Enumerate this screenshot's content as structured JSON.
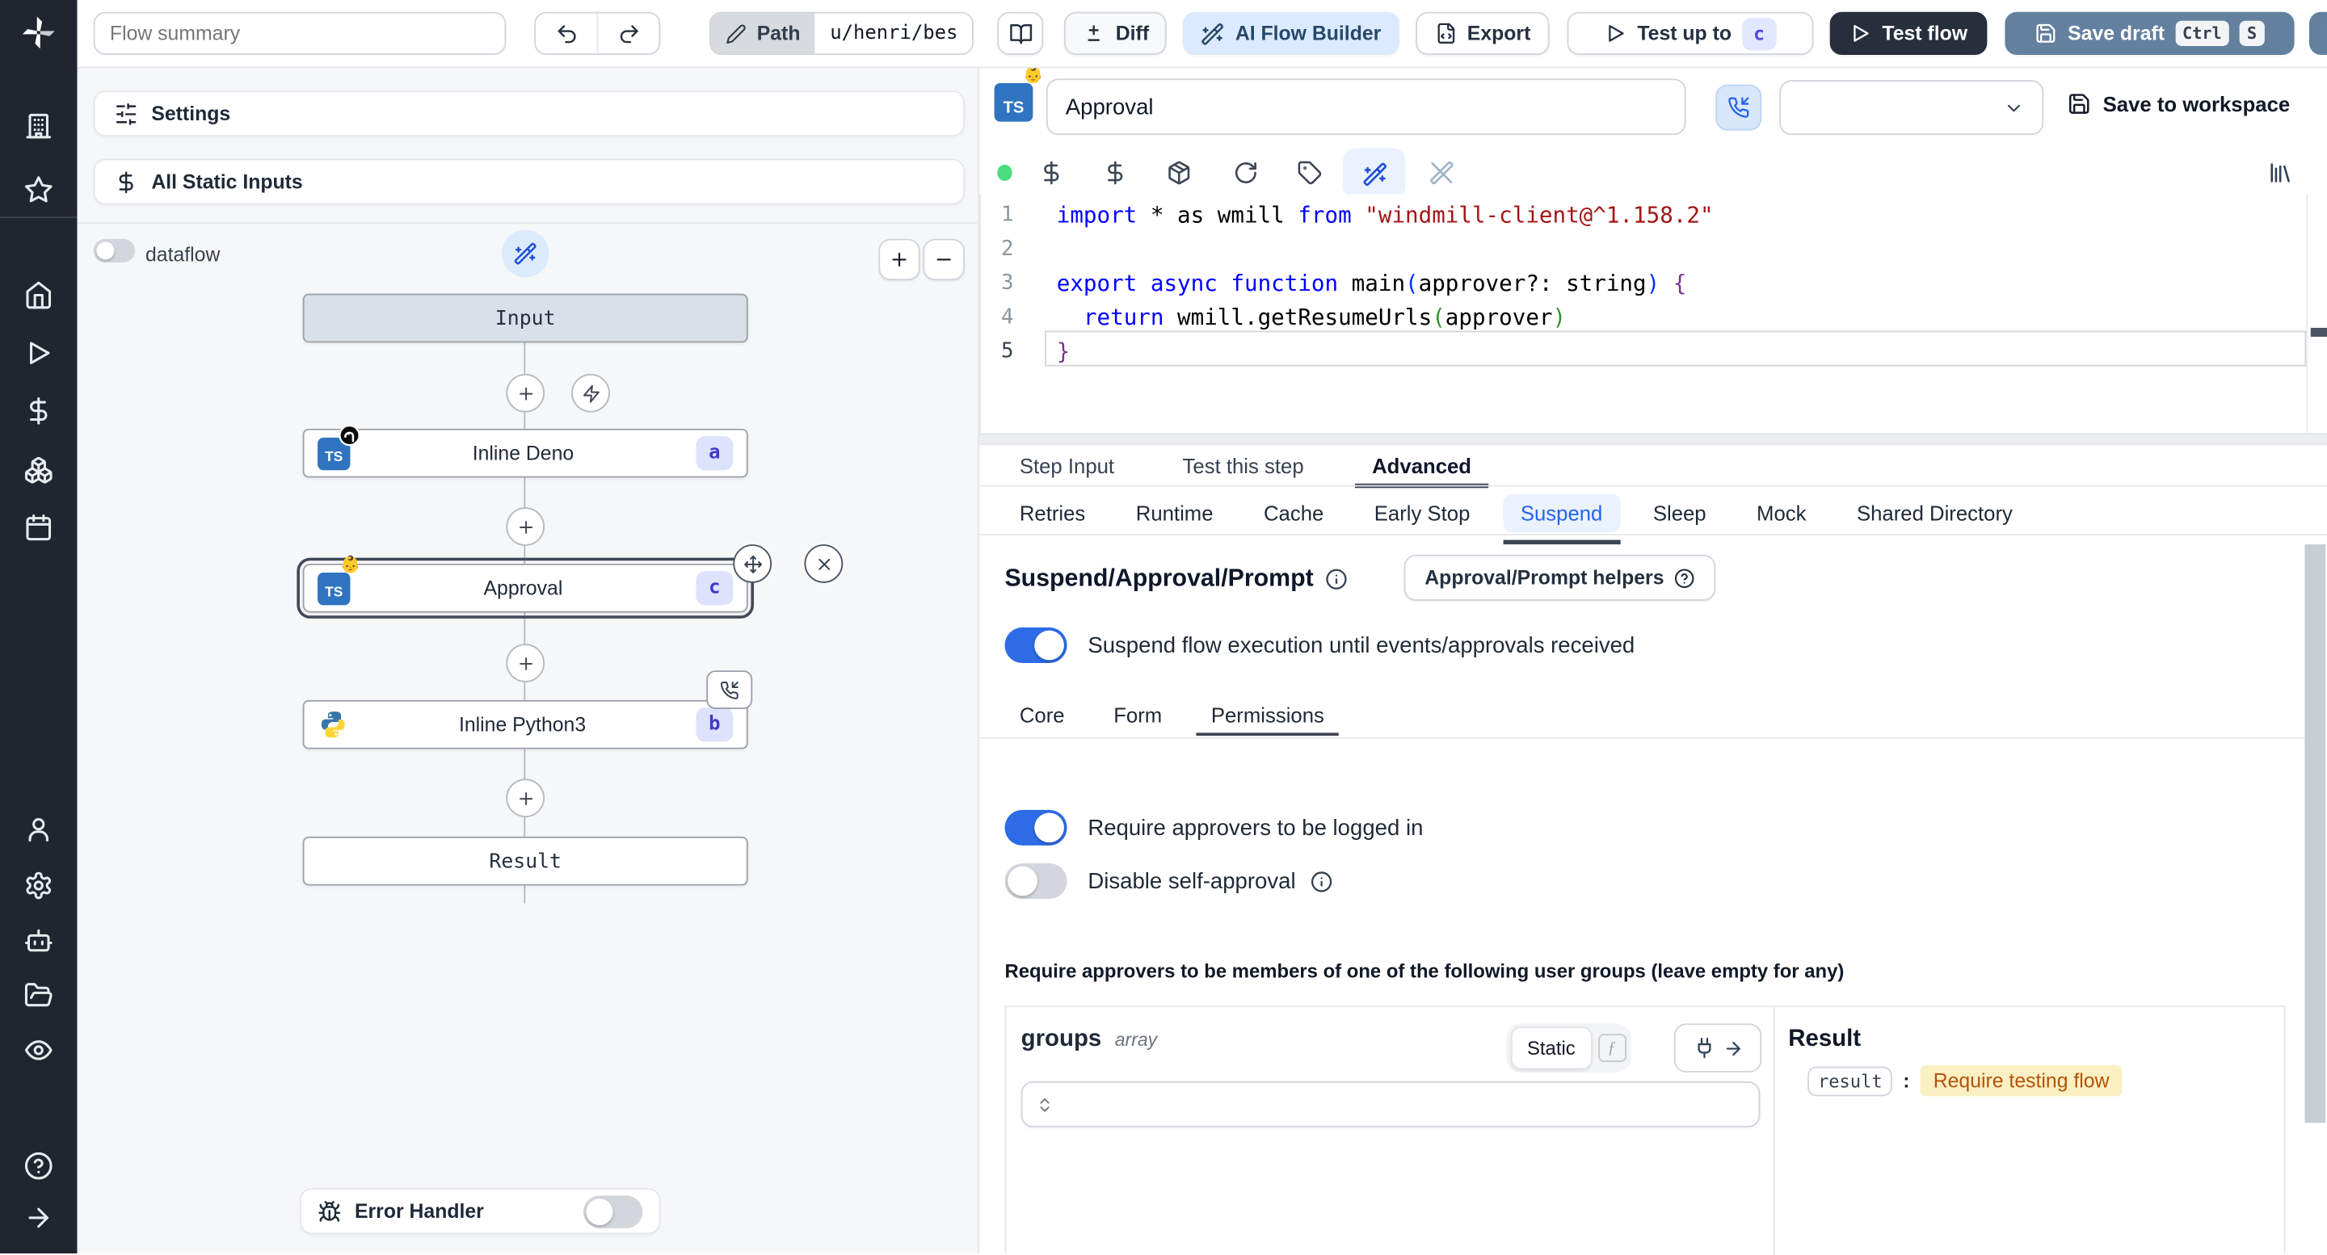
{
  "colors": {
    "accent_blue": "#2e6be6",
    "badge_bg": "#dde3fc",
    "badge_text": "#4338ca",
    "highlight_bg": "#fbf0c4",
    "highlight_text": "#b45309",
    "rail_bg": "#21252f",
    "save_btn": "#64809f",
    "test_flow_btn": "#272f3d"
  },
  "topbar": {
    "flow_summary": "Flow summary",
    "path_label": "Path",
    "path_value": "u/henri/bes",
    "diff_label": "Diff",
    "ai_flow_builder_label": "AI Flow Builder",
    "export_label": "Export",
    "test_up_to_label": "Test up to",
    "test_up_to_badge": "c",
    "test_flow_label": "Test flow",
    "save_draft_label": "Save draft",
    "kbd_ctrl": "Ctrl",
    "kbd_s": "S"
  },
  "rail": {
    "icons": [
      "windmill-logo",
      "building",
      "star",
      "home",
      "play",
      "dollar",
      "boxes",
      "calendar",
      "user",
      "gear",
      "bot",
      "folder",
      "eye",
      "help",
      "arrow-right"
    ]
  },
  "left_panel": {
    "settings_label": "Settings",
    "static_inputs_label": "All Static Inputs",
    "dataflow_label": "dataflow",
    "error_handler_label": "Error Handler",
    "graph": {
      "input_label": "Input",
      "result_label": "Result",
      "nodes": [
        {
          "label": "Inline Deno",
          "badge": "a",
          "lang": "deno"
        },
        {
          "label": "Approval",
          "badge": "c",
          "lang": "deno-approval",
          "emoji": "👶"
        },
        {
          "label": "Inline Python3",
          "badge": "b",
          "lang": "python"
        }
      ]
    }
  },
  "editor": {
    "step_name": "Approval",
    "save_to_workspace_label": "Save to workspace",
    "toolbar_icons": [
      "status-dot",
      "dollar",
      "dollar",
      "package",
      "refresh",
      "tag",
      "wand",
      "wand-off",
      "library"
    ],
    "code": {
      "lines": [
        {
          "n": "1",
          "tokens": [
            [
              "import",
              "kw"
            ],
            [
              " * as wmill ",
              "pl"
            ],
            [
              "from",
              "kw"
            ],
            [
              " ",
              "pl"
            ],
            [
              "\"windmill-client@^1.158.2\"",
              "str"
            ]
          ]
        },
        {
          "n": "2",
          "tokens": []
        },
        {
          "n": "3",
          "tokens": [
            [
              "export",
              "kw"
            ],
            [
              " ",
              "pl"
            ],
            [
              "async",
              "kw"
            ],
            [
              " ",
              "pl"
            ],
            [
              "function",
              "kw"
            ],
            [
              " main",
              "pl"
            ],
            [
              "(",
              "pb"
            ],
            [
              "approver?: string",
              "pl"
            ],
            [
              ")",
              "pb"
            ],
            [
              " ",
              "pl"
            ],
            [
              "{",
              "pp"
            ]
          ]
        },
        {
          "n": "4",
          "tokens": [
            [
              "  ",
              "pl"
            ],
            [
              "return",
              "kw"
            ],
            [
              " wmill.getResumeUrls",
              "pl"
            ],
            [
              "(",
              "pg"
            ],
            [
              "approver",
              "pl"
            ],
            [
              ")",
              "pg"
            ]
          ]
        },
        {
          "n": "5",
          "tokens": [
            [
              "}",
              "pp"
            ]
          ]
        }
      ]
    }
  },
  "tabs": {
    "main": [
      "Step Input",
      "Test this step",
      "Advanced"
    ],
    "advanced": [
      "Retries",
      "Runtime",
      "Cache",
      "Early Stop",
      "Suspend",
      "Sleep",
      "Mock",
      "Shared Directory"
    ]
  },
  "suspend": {
    "title": "Suspend/Approval/Prompt",
    "helpers_button": "Approval/Prompt helpers",
    "suspend_toggle_label": "Suspend flow execution until events/approvals received",
    "sub_tabs": [
      "Core",
      "Form",
      "Permissions"
    ],
    "require_logged_in_label": "Require approvers to be logged in",
    "disable_self_approval_label": "Disable self-approval",
    "groups_hint": "Require approvers to be members of one of the following user groups (leave empty for any)",
    "groups": {
      "name": "groups",
      "type": "array",
      "static_label": "Static",
      "fn_label": "ƒ"
    },
    "result": {
      "title": "Result",
      "key": "result",
      "value": "Require testing flow"
    }
  }
}
